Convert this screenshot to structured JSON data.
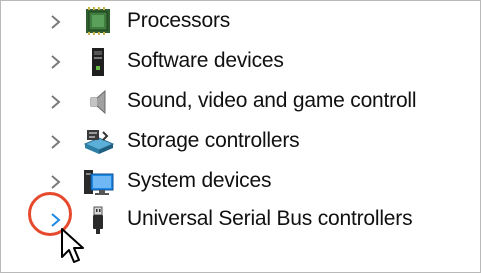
{
  "device_tree": {
    "items": [
      {
        "label": "Processors",
        "icon": "processor-icon"
      },
      {
        "label": "Software devices",
        "icon": "software-device-icon"
      },
      {
        "label": "Sound, video and game controll",
        "icon": "speaker-icon"
      },
      {
        "label": "Storage controllers",
        "icon": "storage-controller-icon"
      },
      {
        "label": "System devices",
        "icon": "system-devices-icon"
      },
      {
        "label": "Universal Serial Bus controllers",
        "icon": "usb-plug-icon"
      }
    ]
  },
  "colors": {
    "chevron": "#7a7a7a",
    "chevron_hover": "#1e88e5",
    "callout_ring": "#e64a2e",
    "text": "#111111",
    "border": "#b9b9b9"
  }
}
